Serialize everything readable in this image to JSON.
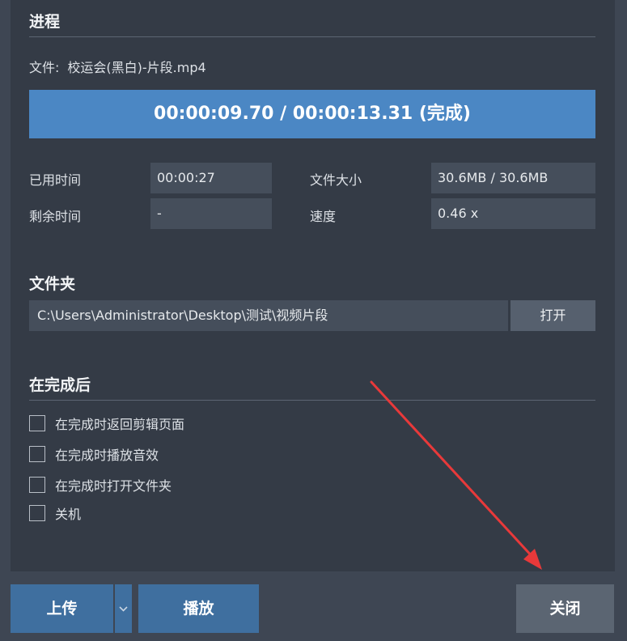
{
  "progress_section": {
    "title": "进程",
    "file_label": "文件:",
    "file_name": "校运会(黑白)-片段.mp4",
    "progress_text": "00:00:09.70 / 00:00:13.31 (完成)",
    "progress_fraction": 1.0
  },
  "stats": {
    "elapsed_label": "已用时间",
    "elapsed_value": "00:00:27",
    "remaining_label": "剩余时间",
    "remaining_value": "-",
    "size_label": "文件大小",
    "size_value": "30.6MB / 30.6MB",
    "speed_label": "速度",
    "speed_value": "0.46 x"
  },
  "folder_section": {
    "title": "文件夹",
    "path": "C:\\Users\\Administrator\\Desktop\\测试\\视频片段",
    "open_label": "打开"
  },
  "after_section": {
    "title": "在完成后",
    "options": [
      {
        "label": "在完成时返回剪辑页面",
        "checked": false
      },
      {
        "label": "在完成时播放音效",
        "checked": false
      },
      {
        "label": "在完成时打开文件夹",
        "checked": false
      },
      {
        "label": "关机",
        "checked": false
      }
    ]
  },
  "buttons": {
    "upload": "上传",
    "play": "播放",
    "close": "关闭"
  },
  "icons": {
    "upload_dropdown": "chevron-down-icon"
  },
  "colors": {
    "accent": "#4b87c4",
    "button_blue": "#3f6f9f",
    "annotation_arrow": "#e8393a"
  }
}
